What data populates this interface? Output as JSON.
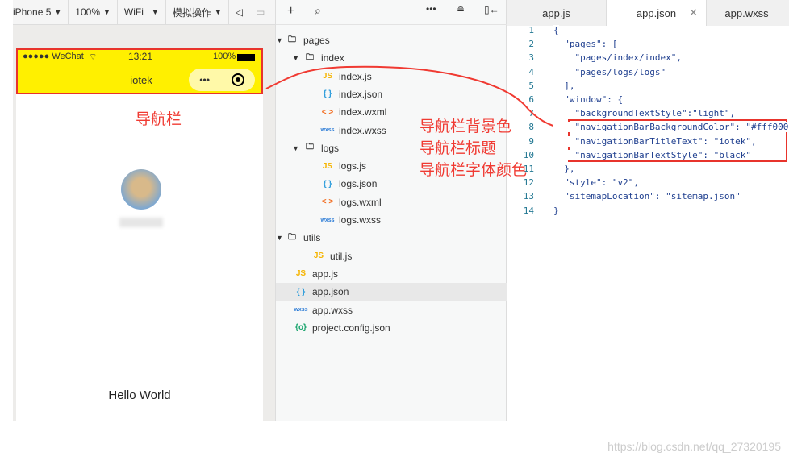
{
  "simulator": {
    "toolbar": {
      "device": "iPhone 5",
      "zoom": "100%",
      "network": "WiFi",
      "ops": "模拟操作"
    },
    "status": {
      "signal": "●●●●● WeChat",
      "time": "13:21",
      "battery": "100%"
    },
    "nav": {
      "title": "iotek",
      "bg_color": "#fff000",
      "more": "•••"
    },
    "page": {
      "hello": "Hello World"
    }
  },
  "tree": {
    "items": [
      {
        "label": "pages",
        "icon": "folder-icon",
        "depth": 0,
        "arrow": true
      },
      {
        "label": "index",
        "icon": "folder-icon",
        "depth": 1,
        "arrow": true
      },
      {
        "label": "index.js",
        "icon": "js-icon",
        "depth": 2
      },
      {
        "label": "index.json",
        "icon": "json-icon",
        "depth": 2
      },
      {
        "label": "index.wxml",
        "icon": "wxml-icon",
        "depth": 2
      },
      {
        "label": "index.wxss",
        "icon": "wxss-icon",
        "depth": 2
      },
      {
        "label": "logs",
        "icon": "folder-icon",
        "depth": 1,
        "arrow": true
      },
      {
        "label": "logs.js",
        "icon": "js-icon",
        "depth": 2
      },
      {
        "label": "logs.json",
        "icon": "json-icon",
        "depth": 2
      },
      {
        "label": "logs.wxml",
        "icon": "wxml-icon",
        "depth": 2
      },
      {
        "label": "logs.wxss",
        "icon": "wxss-icon",
        "depth": 2
      },
      {
        "label": "utils",
        "icon": "folder-icon",
        "depth": 0,
        "arrow": true
      },
      {
        "label": "util.js",
        "icon": "js-icon",
        "depth": 1.5
      },
      {
        "label": "app.js",
        "icon": "js-icon",
        "depth": 0.5
      },
      {
        "label": "app.json",
        "icon": "json-icon",
        "depth": 0.5,
        "selected": true
      },
      {
        "label": "app.wxss",
        "icon": "wxss-icon",
        "depth": 0.5
      },
      {
        "label": "project.config.json",
        "icon": "config-icon",
        "depth": 0.5
      }
    ]
  },
  "editor": {
    "tabs": [
      {
        "label": "app.js"
      },
      {
        "label": "app.json",
        "active": true
      },
      {
        "label": "app.wxss"
      }
    ],
    "lines": [
      "{",
      "  \"pages\": [",
      "    \"pages/index/index\",",
      "    \"pages/logs/logs\"",
      "  ],",
      "  \"window\": {",
      "    \"backgroundTextStyle\":\"light\",",
      "    \"navigationBarBackgroundColor\": \"#fff000\",",
      "    \"navigationBarTitleText\": \"iotek\",",
      "    \"navigationBarTextStyle\": \"black\"",
      "  },",
      "  \"style\": \"v2\",",
      "  \"sitemapLocation\": \"sitemap.json\"",
      "}"
    ]
  },
  "annotations": {
    "nav": "导航栏",
    "bg": "导航栏背景色",
    "title": "导航栏标题",
    "font": "导航栏字体颜色",
    "color": "#f03a32"
  },
  "watermark": "https://blog.csdn.net/qq_27320195"
}
